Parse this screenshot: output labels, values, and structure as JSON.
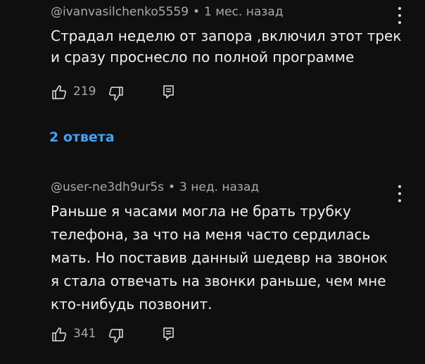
{
  "comments": [
    {
      "author": "@ivanvasilchenko5559",
      "time": "1 мес. назад",
      "text_lines": [
        "Страдал неделю от запора ,включил этот трек",
        "и сразу проснесло по полной программе"
      ],
      "likes": "219"
    },
    {
      "author": "@user-ne3dh9ur5s",
      "time": "3 нед. назад",
      "text_lines": [
        "Раньше я часами могла не брать трубку",
        "телефона, за что на меня часто сердилась",
        "мать. Но поставив данный шедевр на звонок",
        "я стала отвечать на звонки раньше, чем мне",
        "кто-нибудь позвонит."
      ],
      "likes": "341"
    }
  ],
  "separator": "•",
  "replies_label": "2 ответа",
  "icons": [
    "thumb-up-icon",
    "thumb-down-icon",
    "reply-icon",
    "more-vert-icon"
  ],
  "colors": {
    "background": "#0f0f0f",
    "text": "#f1f1f1",
    "meta": "#aaaaaa",
    "link": "#3ea6ff"
  }
}
